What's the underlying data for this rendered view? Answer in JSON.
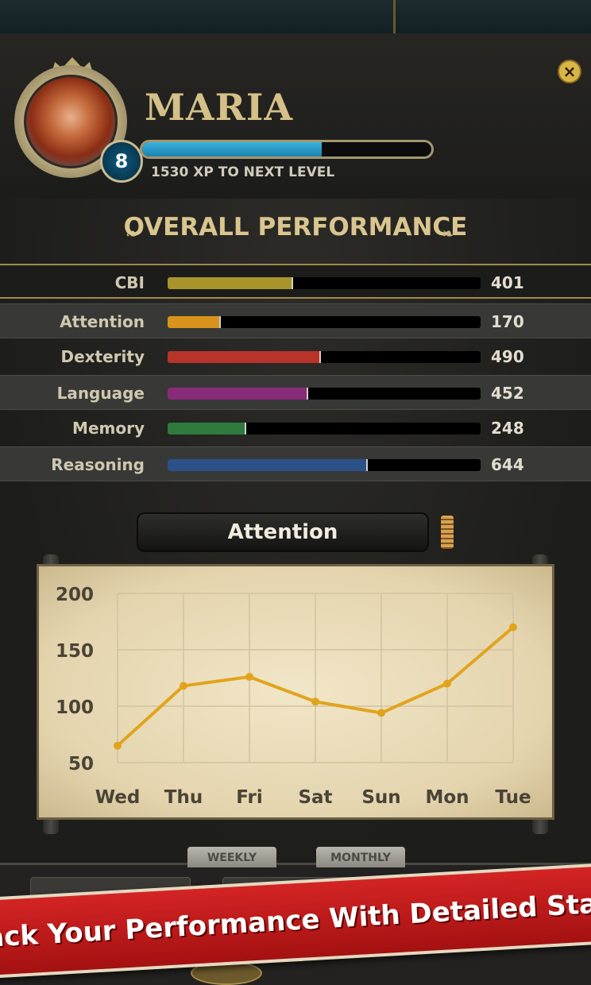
{
  "profile": {
    "name": "MARIA",
    "level": "8",
    "xp_text": "1530 XP TO NEXT LEVEL",
    "xp_progress": 0.62
  },
  "close_label": "×",
  "section_title": "OVERALL PERFORMANCE",
  "stats": [
    {
      "label": "CBI",
      "value": "401",
      "fraction": 0.4,
      "color": "#a8942a"
    },
    {
      "label": "Attention",
      "value": "170",
      "fraction": 0.17,
      "color": "#d9931c"
    },
    {
      "label": "Dexterity",
      "value": "490",
      "fraction": 0.49,
      "color": "#b8332a"
    },
    {
      "label": "Language",
      "value": "452",
      "fraction": 0.45,
      "color": "#8a2b7a"
    },
    {
      "label": "Memory",
      "value": "248",
      "fraction": 0.25,
      "color": "#2f7a3c"
    },
    {
      "label": "Reasoning",
      "value": "644",
      "fraction": 0.64,
      "color": "#2c5188"
    }
  ],
  "chart_selector": "Attention",
  "chart_data": {
    "type": "line",
    "categories": [
      "Wed",
      "Thu",
      "Fri",
      "Sat",
      "Sun",
      "Mon",
      "Tue"
    ],
    "series": [
      {
        "values": [
          65,
          118,
          126,
          104,
          94,
          120,
          170
        ]
      }
    ],
    "ylim": [
      50,
      200
    ],
    "yticks": [
      50,
      100,
      150,
      200
    ],
    "grid": true,
    "line_color": "#e0a41c"
  },
  "tabs": {
    "weekly": "WEEKLY",
    "monthly": "MONTHLY"
  },
  "banner_text": "Track Your Performance With Detailed Stats!"
}
